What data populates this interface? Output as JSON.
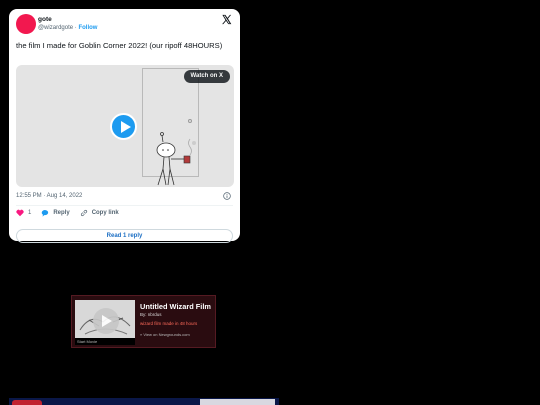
{
  "tweet": {
    "author_name": "gote",
    "handle": "@wizardgote",
    "separator": "·",
    "follow_label": "Follow",
    "text": "the film I made for Goblin Corner 2022! (our ripoff 48HOURS)",
    "watch_label": "Watch on X",
    "timestamp": "12:55 PM · Aug 14, 2022",
    "like_count": "1",
    "reply_label": "Reply",
    "copy_link_label": "Copy link",
    "read_reply_label": "Read 1 reply",
    "colors": {
      "accent": "#1d9bf0",
      "avatar": "#f2184f",
      "like": "#f91880"
    }
  },
  "newgrounds": {
    "title": "Untitled Wizard Film",
    "by": "By: nbrdus",
    "description": "wizard film made in 48 hours",
    "link": "» View on Newgrounds.com",
    "start_label": "Start Movie"
  }
}
